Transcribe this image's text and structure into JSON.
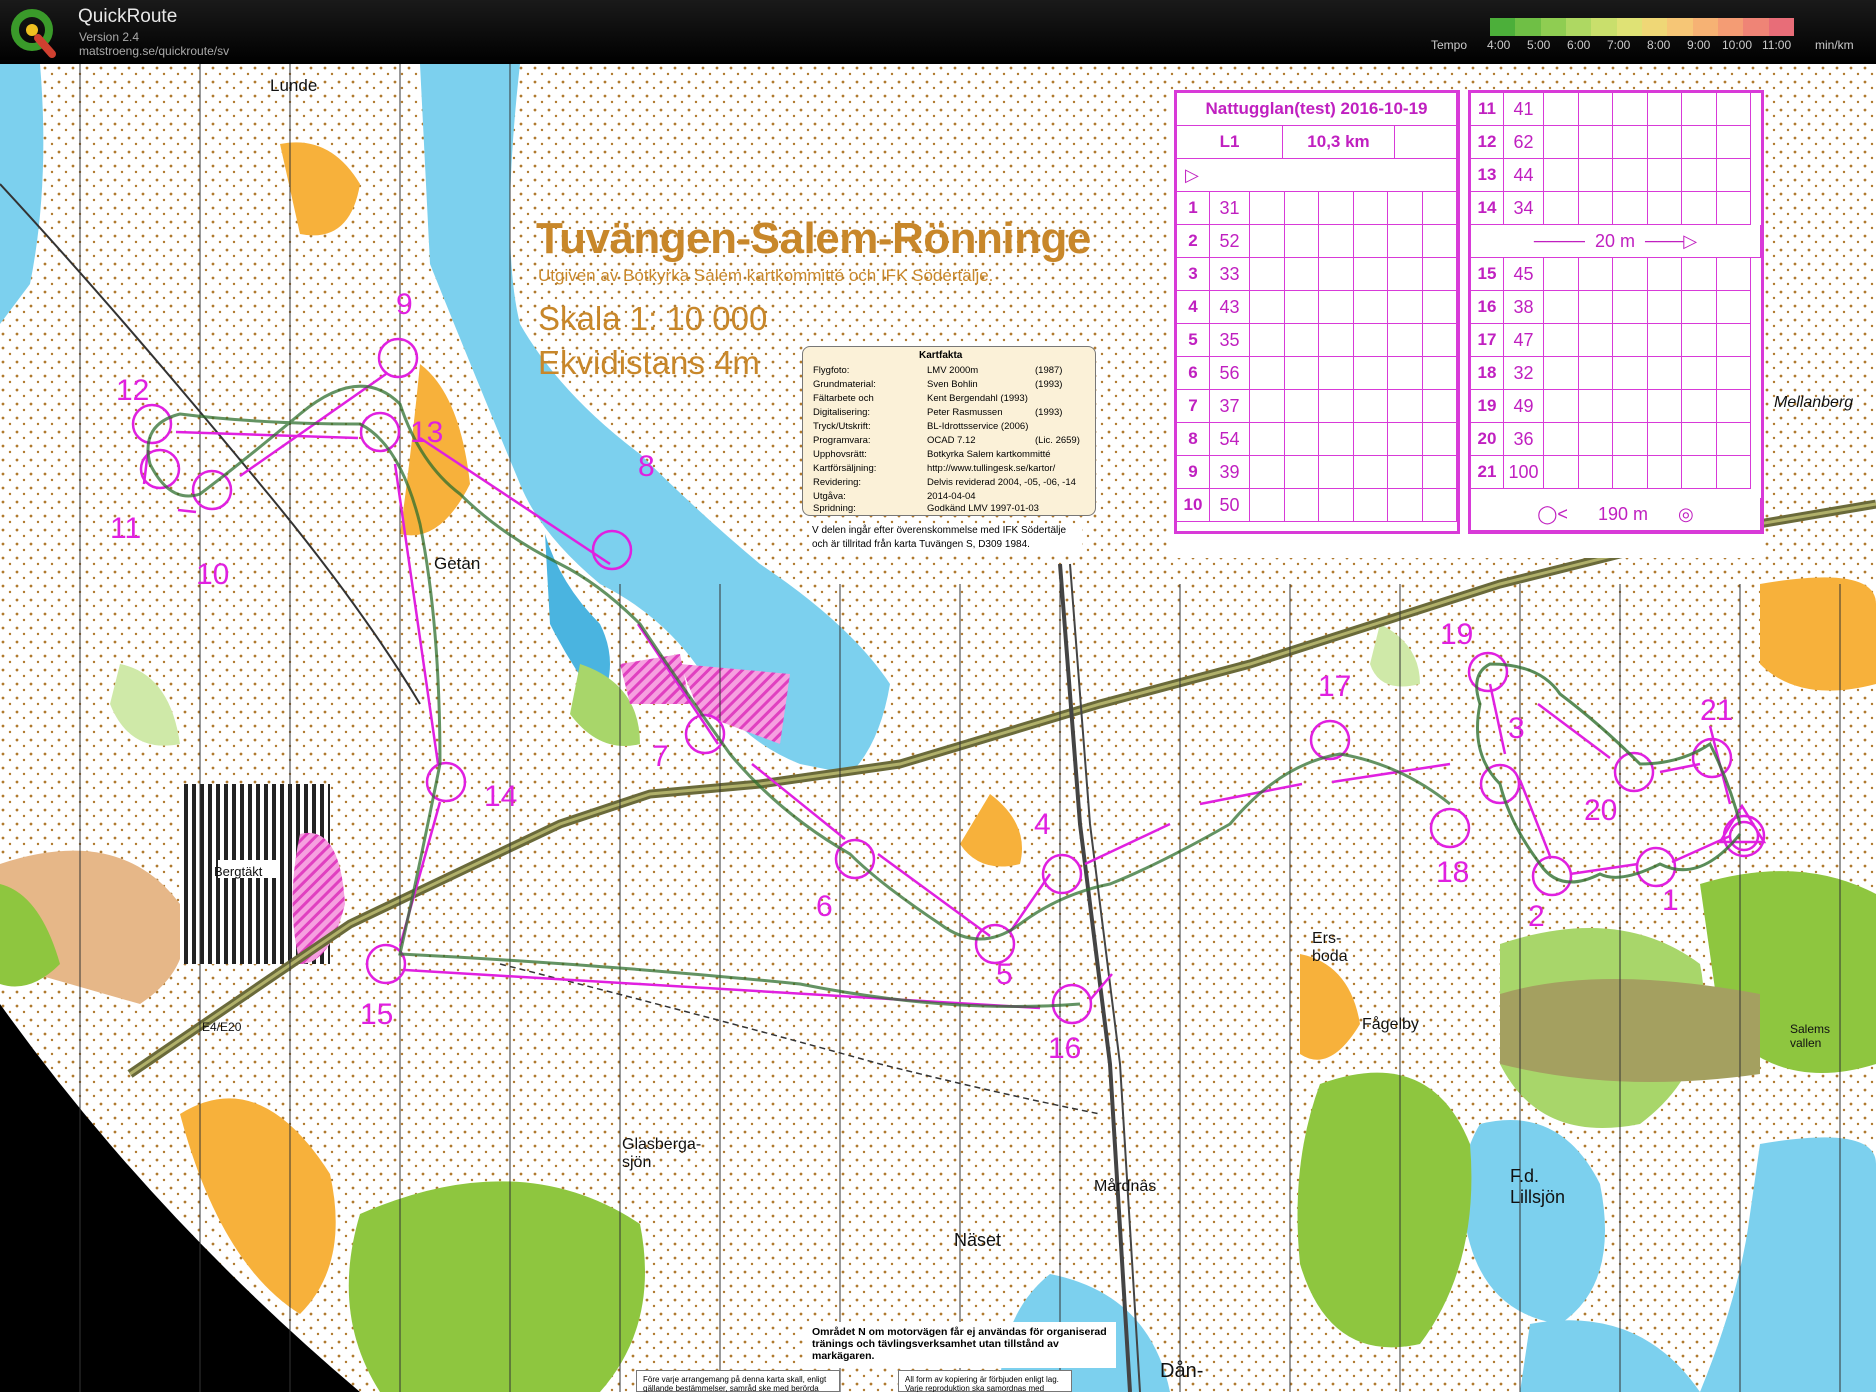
{
  "header": {
    "app_title": "QuickRoute",
    "version": "Version 2.4",
    "url": "matstroeng.se/quickroute/sv",
    "tempo_label": "Tempo",
    "tempo_ticks": [
      "4:00",
      "5:00",
      "6:00",
      "7:00",
      "8:00",
      "9:00",
      "10:00",
      "11:00"
    ],
    "tempo_unit": "min/km",
    "tempo_colors": [
      "#4caf3a",
      "#6fbf45",
      "#8fcd52",
      "#aed862",
      "#c9df6c",
      "#dfe275",
      "#efd776",
      "#f6c676",
      "#f6b274",
      "#f49c74",
      "#ef8476",
      "#e86d78"
    ]
  },
  "map": {
    "title": "Tuvängen-Salem-Rönninge",
    "subtitle": "Utgiven av Botkyrka Salem kartkommitté och IFK Södertälje.",
    "scale": "Skala 1: 10 000",
    "equidistance": "Ekvidistans 4m",
    "kartfakta": {
      "title": "Kartfakta",
      "rows": [
        {
          "label": "Flygfoto:",
          "value": "LMV 2000m",
          "year": "(1987)"
        },
        {
          "label": "Grundmaterial:",
          "value": "Sven Bohlin",
          "year": "(1993)"
        },
        {
          "label": "Fältarbete och",
          "value": "Kent Bergendahl (1993)",
          "year": ""
        },
        {
          "label": "Digitalisering:",
          "value": "Peter Rasmussen",
          "year": "(1993)"
        },
        {
          "label": "Tryck/Utskrift:",
          "value": "BL-Idrottsservice (2006)",
          "year": ""
        },
        {
          "label": "Programvara:",
          "value": "OCAD 7.12",
          "year": "(Lic. 2659)"
        },
        {
          "label": "Upphovsrätt:",
          "value": "Botkyrka Salem kartkommitté",
          "year": ""
        },
        {
          "label": "Kartförsäljning:",
          "value": "http://www.tullingesk.se/kartor/",
          "year": ""
        },
        {
          "label": "Revidering:",
          "value": "Delvis reviderad 2004, -05, -06, -14",
          "year": ""
        },
        {
          "label": "Utgåva:",
          "value": "2014-04-04",
          "year": ""
        },
        {
          "label": "Spridning:",
          "value": "Godkänd LMV 1997-01-03",
          "year": ""
        }
      ],
      "note": "V delen ingår efter överenskommelse med IFK Södertälje och är tillritad från karta Tuvängen S, D309 1984."
    },
    "notice_north": "Området N om motorvägen får ej användas för organiserad tränings och tävlingsverksamhet utan tillstånd av markägaren.",
    "notice_bottom_left": "Före varje arrangemang på denna karta skall, enligt gällande bestämmelser, samråd ske med berörda",
    "notice_bottom_right": "All form av kopiering är förbjuden enligt lag. Varje reproduktion ska samordnas med Botkyrka Salem",
    "place_names": [
      "Lunde",
      "Getan",
      "Bergtäkt",
      "Glasberga-sjön",
      "Mellanberg",
      "Ers-boda",
      "Fågelby",
      "Salems vallen",
      "Mårdnäs",
      "Näset",
      "F.d. Lillsjön",
      "Dån-",
      "E4/E20"
    ],
    "controls": [
      "1",
      "2",
      "3",
      "4",
      "5",
      "6",
      "7",
      "8",
      "9",
      "10",
      "11",
      "12",
      "13",
      "14",
      "15",
      "16",
      "17",
      "18",
      "19",
      "20",
      "21"
    ]
  },
  "control_description": {
    "event": "Nattugglan(test) 2016-10-19",
    "class": "L1",
    "length": "10,3 km",
    "rows_left": [
      {
        "n": "1",
        "code": "31"
      },
      {
        "n": "2",
        "code": "52"
      },
      {
        "n": "3",
        "code": "33"
      },
      {
        "n": "4",
        "code": "43"
      },
      {
        "n": "5",
        "code": "35"
      },
      {
        "n": "6",
        "code": "56"
      },
      {
        "n": "7",
        "code": "37"
      },
      {
        "n": "8",
        "code": "54"
      },
      {
        "n": "9",
        "code": "39"
      },
      {
        "n": "10",
        "code": "50"
      }
    ],
    "rows_right": [
      {
        "n": "11",
        "code": "41"
      },
      {
        "n": "12",
        "code": "62"
      },
      {
        "n": "13",
        "code": "44"
      },
      {
        "n": "14",
        "code": "34"
      },
      {
        "n": "15",
        "code": "45"
      },
      {
        "n": "16",
        "code": "38"
      },
      {
        "n": "17",
        "code": "47"
      },
      {
        "n": "18",
        "code": "32"
      },
      {
        "n": "19",
        "code": "49"
      },
      {
        "n": "20",
        "code": "36"
      },
      {
        "n": "21",
        "code": "100"
      }
    ],
    "taped_route": "20 m",
    "finish_distance": "190 m"
  }
}
